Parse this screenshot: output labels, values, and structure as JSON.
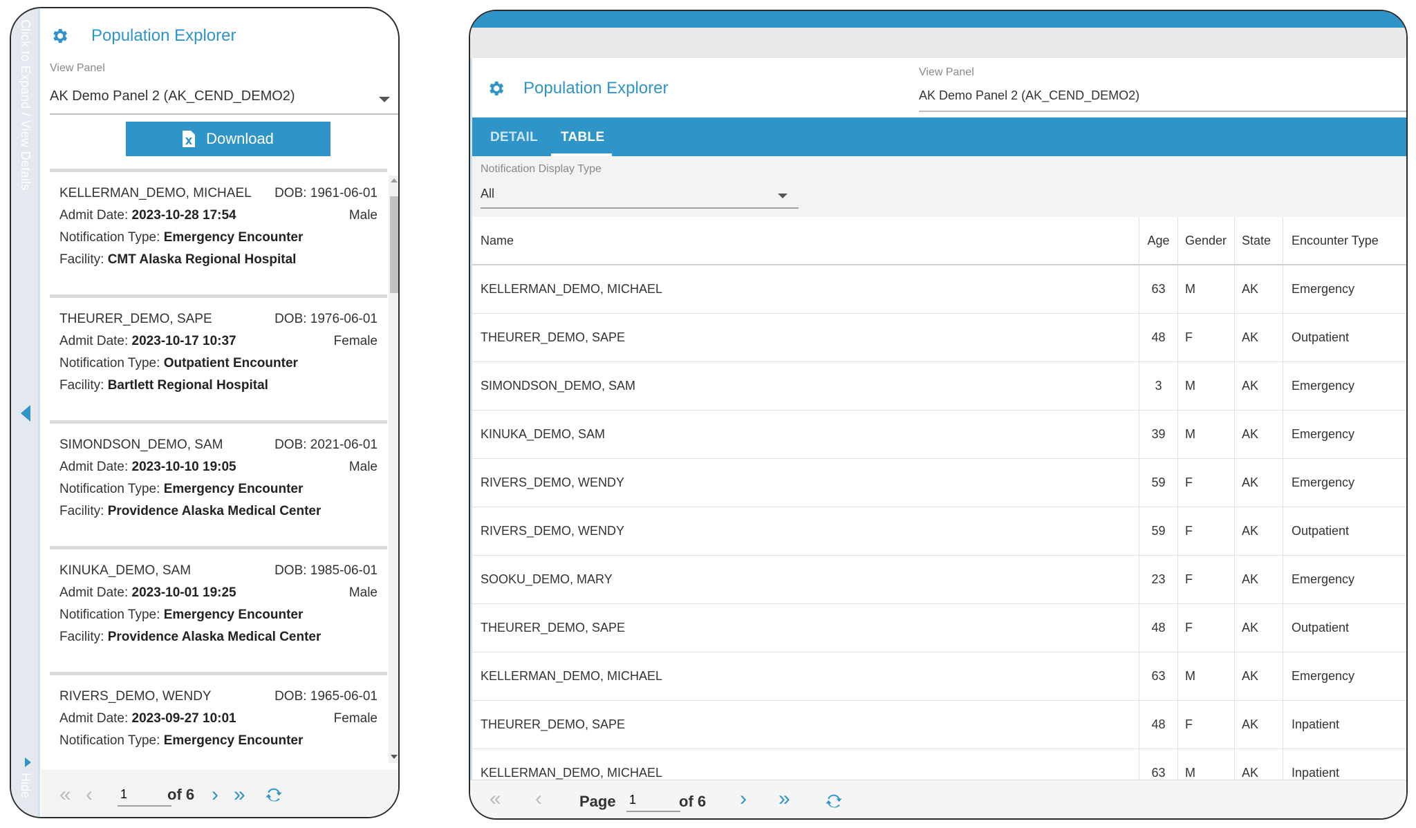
{
  "left_panel": {
    "side_strip_text": "Click to Expand / View Details",
    "side_strip_hide": "Hide",
    "title": "Population Explorer",
    "view_panel_label": "View Panel",
    "view_panel_value": "AK Demo Panel 2 (AK_CEND_DEMO2)",
    "download_label": "Download",
    "cards": [
      {
        "name": "KELLERMAN_DEMO, MICHAEL",
        "dob_label": "DOB:",
        "dob": "1961-06-01",
        "admit_label": "Admit Date:",
        "admit": "2023-10-28 17:54",
        "gender": "Male",
        "notif_label": "Notification Type:",
        "notif": "Emergency Encounter",
        "facility_label": "Facility:",
        "facility": "CMT Alaska Regional Hospital"
      },
      {
        "name": "THEURER_DEMO, SAPE",
        "dob_label": "DOB:",
        "dob": "1976-06-01",
        "admit_label": "Admit Date:",
        "admit": "2023-10-17 10:37",
        "gender": "Female",
        "notif_label": "Notification Type:",
        "notif": "Outpatient Encounter",
        "facility_label": "Facility:",
        "facility": "Bartlett Regional Hospital"
      },
      {
        "name": "SIMONDSON_DEMO, SAM",
        "dob_label": "DOB:",
        "dob": "2021-06-01",
        "admit_label": "Admit Date:",
        "admit": "2023-10-10 19:05",
        "gender": "Male",
        "notif_label": "Notification Type:",
        "notif": "Emergency Encounter",
        "facility_label": "Facility:",
        "facility": "Providence Alaska Medical Center"
      },
      {
        "name": "KINUKA_DEMO, SAM",
        "dob_label": "DOB:",
        "dob": "1985-06-01",
        "admit_label": "Admit Date:",
        "admit": "2023-10-01 19:25",
        "gender": "Male",
        "notif_label": "Notification Type:",
        "notif": "Emergency Encounter",
        "facility_label": "Facility:",
        "facility": "Providence Alaska Medical Center"
      },
      {
        "name": "RIVERS_DEMO, WENDY",
        "dob_label": "DOB:",
        "dob": "1965-06-01",
        "admit_label": "Admit Date:",
        "admit": "2023-09-27 10:01",
        "gender": "Female",
        "notif_label": "Notification Type:",
        "notif": "Emergency Encounter",
        "facility_label": "",
        "facility": ""
      }
    ],
    "pager": {
      "page": "1",
      "of": "of 6"
    }
  },
  "right_panel": {
    "title": "Population Explorer",
    "view_panel_label": "View Panel",
    "view_panel_value": "AK Demo Panel 2 (AK_CEND_DEMO2)",
    "tabs": [
      {
        "label": "DETAIL",
        "active": false
      },
      {
        "label": "TABLE",
        "active": true
      }
    ],
    "filter_label": "Notification Display Type",
    "filter_value": "All",
    "table": {
      "columns": [
        "Name",
        "Age",
        "Gender",
        "State",
        "Encounter Type"
      ],
      "rows": [
        [
          "KELLERMAN_DEMO, MICHAEL",
          "63",
          "M",
          "AK",
          "Emergency"
        ],
        [
          "THEURER_DEMO, SAPE",
          "48",
          "F",
          "AK",
          "Outpatient"
        ],
        [
          "SIMONDSON_DEMO, SAM",
          "3",
          "M",
          "AK",
          "Emergency"
        ],
        [
          "KINUKA_DEMO, SAM",
          "39",
          "M",
          "AK",
          "Emergency"
        ],
        [
          "RIVERS_DEMO, WENDY",
          "59",
          "F",
          "AK",
          "Emergency"
        ],
        [
          "RIVERS_DEMO, WENDY",
          "59",
          "F",
          "AK",
          "Outpatient"
        ],
        [
          "SOOKU_DEMO, MARY",
          "23",
          "F",
          "AK",
          "Emergency"
        ],
        [
          "THEURER_DEMO, SAPE",
          "48",
          "F",
          "AK",
          "Outpatient"
        ],
        [
          "KELLERMAN_DEMO, MICHAEL",
          "63",
          "M",
          "AK",
          "Emergency"
        ],
        [
          "THEURER_DEMO, SAPE",
          "48",
          "F",
          "AK",
          "Inpatient"
        ],
        [
          "KELLERMAN_DEMO, MICHAEL",
          "63",
          "M",
          "AK",
          "Inpatient"
        ]
      ]
    },
    "pager": {
      "page_label": "Page",
      "page": "1",
      "of": "of 6"
    }
  },
  "colors": {
    "accent": "#2f94c8",
    "strip": "#e3e9ef"
  },
  "icons": [
    "gear-icon",
    "file-excel-icon",
    "first-page-icon",
    "prev-page-icon",
    "next-page-icon",
    "last-page-icon",
    "refresh-icon",
    "collapse-arrow-icon"
  ]
}
